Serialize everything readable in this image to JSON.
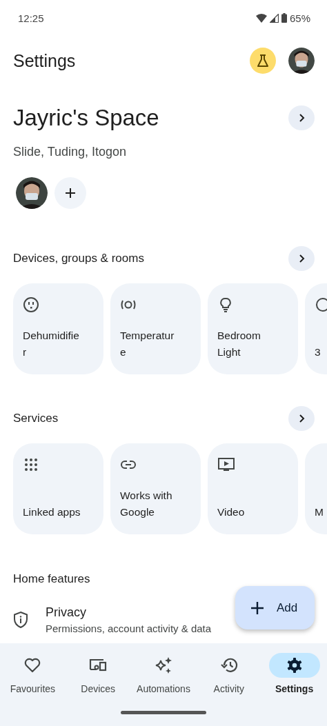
{
  "status_bar": {
    "time": "12:25",
    "battery": "65%"
  },
  "header": {
    "title": "Settings"
  },
  "home": {
    "name": "Jayric's Space",
    "address": "Slide, Tuding, Itogon"
  },
  "sections": [
    {
      "title": "Devices, groups & rooms",
      "tiles": [
        {
          "label": "Dehumidifier"
        },
        {
          "label": "Temperature"
        },
        {
          "label": "Bedroom Light"
        },
        {
          "label": "3"
        }
      ]
    },
    {
      "title": "Services",
      "tiles": [
        {
          "label": "Linked apps"
        },
        {
          "label": "Works with Google"
        },
        {
          "label": "Video"
        },
        {
          "label": "M"
        }
      ]
    }
  ],
  "home_features": {
    "title": "Home features",
    "items": [
      {
        "title": "Privacy",
        "subtitle": "Permissions, account activity & data"
      }
    ]
  },
  "fab": {
    "label": "Add"
  },
  "nav": [
    {
      "label": "Favourites",
      "selected": false
    },
    {
      "label": "Devices",
      "selected": false
    },
    {
      "label": "Automations",
      "selected": false
    },
    {
      "label": "Activity",
      "selected": false
    },
    {
      "label": "Settings",
      "selected": true
    }
  ]
}
